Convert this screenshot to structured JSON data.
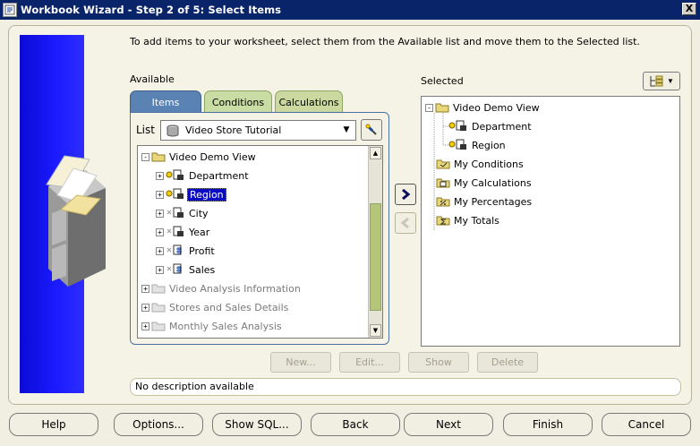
{
  "window": {
    "title": "Workbook Wizard - Step 2 of 5: Select Items",
    "close_glyph": "X"
  },
  "instruction": "To add items to your worksheet, select them from the Available list and move them to the Selected list.",
  "available": {
    "label": "Available",
    "tabs": [
      {
        "label": "Items"
      },
      {
        "label": "Conditions"
      },
      {
        "label": "Calculations"
      }
    ],
    "list_label": "List",
    "list_value": "Video Store Tutorial",
    "tree": [
      {
        "label": "Video Demo View",
        "state": "expanded",
        "level": 0
      },
      {
        "label": "Department",
        "level": 1
      },
      {
        "label": "Region",
        "level": 1,
        "selected": true
      },
      {
        "label": "City",
        "level": 1
      },
      {
        "label": "Year",
        "level": 1
      },
      {
        "label": "Profit",
        "level": 1
      },
      {
        "label": "Sales",
        "level": 1
      },
      {
        "label": "Video Analysis Information",
        "level": 0,
        "greyed": true
      },
      {
        "label": "Stores and Sales Details",
        "level": 0,
        "greyed": true
      },
      {
        "label": "Monthly Sales Analysis",
        "level": 0,
        "greyed": true
      }
    ]
  },
  "selected": {
    "label": "Selected",
    "tree": [
      {
        "label": "Video Demo View",
        "level": 0
      },
      {
        "label": "Department",
        "level": 1
      },
      {
        "label": "Region",
        "level": 1
      },
      {
        "label": "My Conditions",
        "level": 0
      },
      {
        "label": "My Calculations",
        "level": 0
      },
      {
        "label": "My Percentages",
        "level": 0
      },
      {
        "label": "My Totals",
        "level": 0
      }
    ]
  },
  "actions": {
    "new": "New...",
    "edit": "Edit...",
    "show": "Show",
    "delete": "Delete"
  },
  "description": "No description available",
  "buttons": {
    "help": "Help",
    "options": "Options...",
    "show_sql": "Show SQL...",
    "back": "Back",
    "next": "Next",
    "finish": "Finish",
    "cancel": "Cancel"
  },
  "colors": {
    "titlebar": "#0a246a",
    "tab_active": "#5a83b3",
    "tab_inactive": "#c9dca4",
    "selection": "#0b0bc2",
    "side_image": "#1a1aff"
  }
}
